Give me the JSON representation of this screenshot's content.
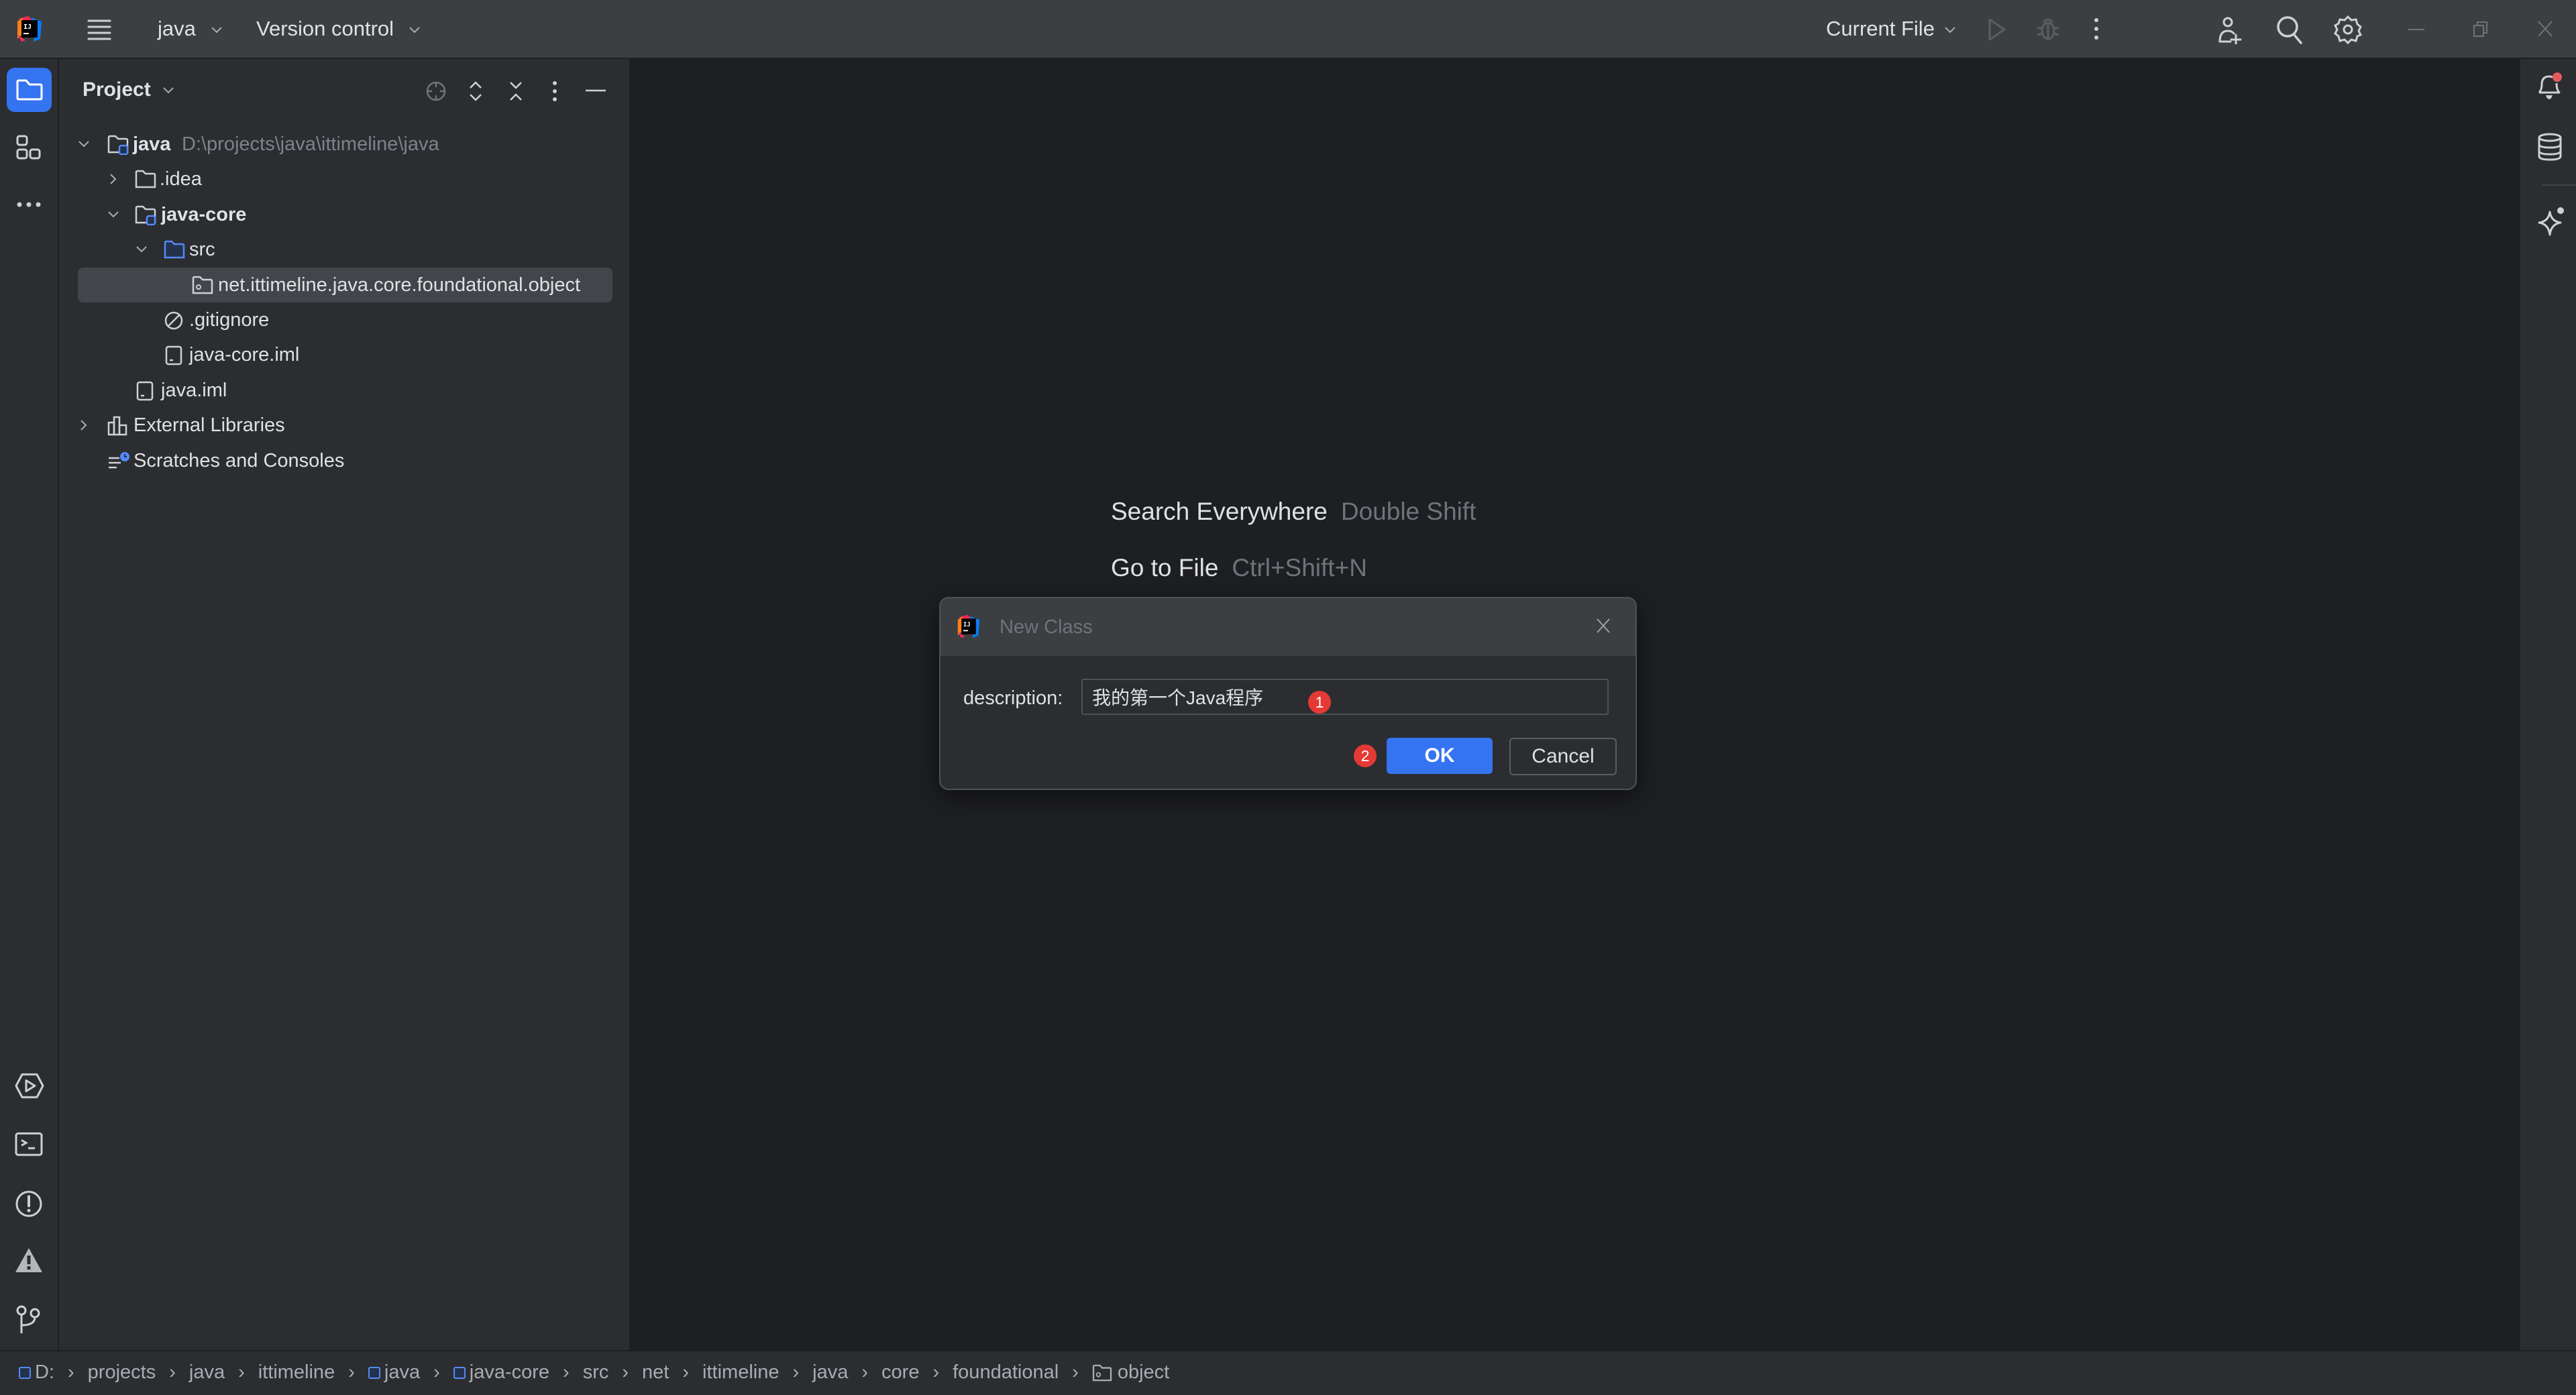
{
  "titlebar": {
    "app_logo": "intellij-idea-logo",
    "project_name": "java",
    "vcs_label": "Version control",
    "run_config": "Current File",
    "icons": [
      "main-menu-icon",
      "run-icon",
      "debug-icon",
      "more-actions-icon",
      "add-user-icon",
      "search-icon",
      "settings-icon",
      "minimize-icon",
      "restore-icon",
      "close-icon"
    ]
  },
  "left_toolbar": {
    "top_items": [
      {
        "name": "project",
        "icon": "folder-icon",
        "active": true
      },
      {
        "name": "structure",
        "icon": "structure-icon",
        "active": false
      },
      {
        "name": "more",
        "icon": "more-horizontal-icon",
        "active": false
      }
    ],
    "bottom_items": [
      {
        "name": "run",
        "icon": "run-services-icon"
      },
      {
        "name": "terminal",
        "icon": "terminal-icon"
      },
      {
        "name": "problems",
        "icon": "problems-icon"
      },
      {
        "name": "warnings",
        "icon": "warning-icon"
      },
      {
        "name": "git",
        "icon": "git-branch-icon"
      }
    ]
  },
  "right_toolbar": {
    "items": [
      {
        "name": "notifications",
        "icon": "bell-icon",
        "has_badge": true
      },
      {
        "name": "database",
        "icon": "database-icon"
      },
      {
        "name": "ai-assistant",
        "icon": "sparkle-icon"
      }
    ]
  },
  "project_panel": {
    "title": "Project",
    "header_icons": [
      "locate-icon",
      "expand-all-icon",
      "collapse-all-icon",
      "options-icon",
      "hide-icon"
    ],
    "tree": [
      {
        "label": "java",
        "secondary": "D:\\projects\\java\\ittimeline\\java",
        "icon": "module-folder-icon",
        "expanded": true,
        "bold": true
      },
      {
        "label": ".idea",
        "icon": "folder-icon",
        "expanded": false
      },
      {
        "label": "java-core",
        "icon": "module-folder-icon",
        "expanded": true,
        "bold": true
      },
      {
        "label": "src",
        "icon": "source-folder-icon",
        "expanded": true
      },
      {
        "label": "net.ittimeline.java.core.foundational.object",
        "icon": "package-icon",
        "selected": true
      },
      {
        "label": ".gitignore",
        "icon": "ignore-file-icon"
      },
      {
        "label": "java-core.iml",
        "icon": "iml-file-icon"
      },
      {
        "label": "java.iml",
        "icon": "iml-file-icon"
      },
      {
        "label": "External Libraries",
        "icon": "libraries-icon",
        "expanded": false
      },
      {
        "label": "Scratches and Consoles",
        "icon": "scratches-icon"
      }
    ]
  },
  "editor": {
    "hints": [
      {
        "action": "Search Everywhere",
        "shortcut": "Double Shift"
      },
      {
        "action": "Go to File",
        "shortcut": "Ctrl+Shift+N"
      }
    ]
  },
  "dialog": {
    "title": "New Class",
    "field_label": "description:",
    "field_value": "我的第一个Java程序",
    "badge_1": "1",
    "badge_2": "2",
    "ok_label": "OK",
    "cancel_label": "Cancel"
  },
  "breadcrumbs": {
    "items": [
      {
        "label": "D:",
        "icon": "module-icon"
      },
      {
        "label": "projects"
      },
      {
        "label": "java"
      },
      {
        "label": "ittimeline"
      },
      {
        "label": "java",
        "icon": "module-icon"
      },
      {
        "label": "java-core",
        "icon": "module-icon"
      },
      {
        "label": "src"
      },
      {
        "label": "net"
      },
      {
        "label": "ittimeline"
      },
      {
        "label": "java"
      },
      {
        "label": "core"
      },
      {
        "label": "foundational"
      },
      {
        "label": "object",
        "icon": "package-icon"
      }
    ]
  },
  "colors": {
    "accent": "#3574f0",
    "badge_red": "#e53935",
    "titlebar_bg": "#3c3f41",
    "panel_bg": "#2b2d30",
    "editor_bg": "#1e1f22",
    "selection_bg": "#43454a"
  }
}
